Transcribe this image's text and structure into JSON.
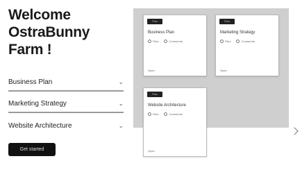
{
  "welcome": {
    "title": "Welcome OstraBunny Farm !"
  },
  "menu": {
    "items": [
      {
        "label": "Business Plan"
      },
      {
        "label": "Marketing Strategy"
      },
      {
        "label": "Website Architecture"
      }
    ]
  },
  "cta": {
    "label": "Get started"
  },
  "board": {
    "cards": [
      {
        "tag": "Plan",
        "title": "Business Plan",
        "meta1": "Files",
        "meta2": "Comments",
        "footer": "Open"
      },
      {
        "tag": "Plan",
        "title": "Marketing Strategy",
        "meta1": "Files",
        "meta2": "Comments",
        "footer": "Open"
      },
      {
        "tag": "Plan",
        "title": "Website Architecture",
        "meta1": "Files",
        "meta2": "Comments",
        "footer": "Open"
      }
    ]
  },
  "colors": {
    "board_bg": "#cfcfcf",
    "cta_bg": "#111111",
    "divider": "#9a9a9a"
  },
  "icons": {
    "menu_chevron": "chevron-down-icon",
    "meta_icon": "circle-icon",
    "resize": "resize-icon"
  }
}
